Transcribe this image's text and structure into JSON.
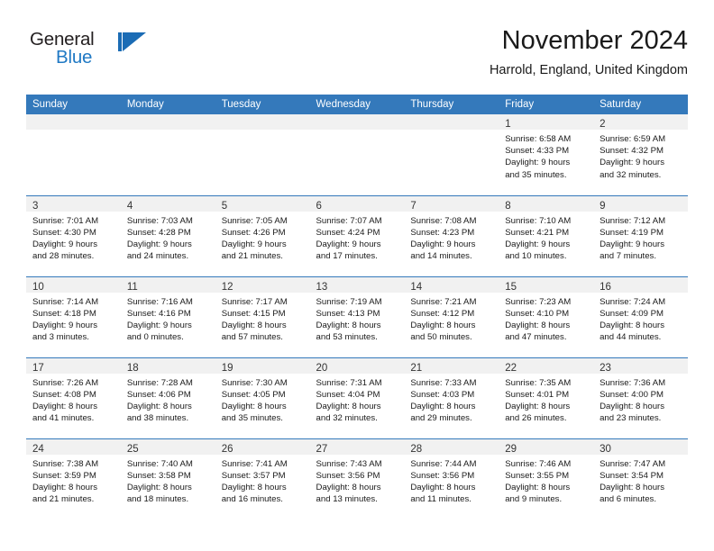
{
  "brand": {
    "name_part1": "General",
    "name_part2": "Blue",
    "accent_color": "#2079c4",
    "logo_icon": "triangle-flag-icon"
  },
  "header": {
    "title": "November 2024",
    "location": "Harrold, England, United Kingdom"
  },
  "calendar": {
    "header_bg": "#3479bb",
    "daynum_band_bg": "#f1f1f1",
    "weekday_headers": [
      "Sunday",
      "Monday",
      "Tuesday",
      "Wednesday",
      "Thursday",
      "Friday",
      "Saturday"
    ],
    "weeks": [
      [
        {
          "day": "",
          "empty": true,
          "lines": []
        },
        {
          "day": "",
          "empty": true,
          "lines": []
        },
        {
          "day": "",
          "empty": true,
          "lines": []
        },
        {
          "day": "",
          "empty": true,
          "lines": []
        },
        {
          "day": "",
          "empty": true,
          "lines": []
        },
        {
          "day": "1",
          "empty": false,
          "lines": [
            "Sunrise: 6:58 AM",
            "Sunset: 4:33 PM",
            "Daylight: 9 hours",
            "and 35 minutes."
          ]
        },
        {
          "day": "2",
          "empty": false,
          "lines": [
            "Sunrise: 6:59 AM",
            "Sunset: 4:32 PM",
            "Daylight: 9 hours",
            "and 32 minutes."
          ]
        }
      ],
      [
        {
          "day": "3",
          "empty": false,
          "lines": [
            "Sunrise: 7:01 AM",
            "Sunset: 4:30 PM",
            "Daylight: 9 hours",
            "and 28 minutes."
          ]
        },
        {
          "day": "4",
          "empty": false,
          "lines": [
            "Sunrise: 7:03 AM",
            "Sunset: 4:28 PM",
            "Daylight: 9 hours",
            "and 24 minutes."
          ]
        },
        {
          "day": "5",
          "empty": false,
          "lines": [
            "Sunrise: 7:05 AM",
            "Sunset: 4:26 PM",
            "Daylight: 9 hours",
            "and 21 minutes."
          ]
        },
        {
          "day": "6",
          "empty": false,
          "lines": [
            "Sunrise: 7:07 AM",
            "Sunset: 4:24 PM",
            "Daylight: 9 hours",
            "and 17 minutes."
          ]
        },
        {
          "day": "7",
          "empty": false,
          "lines": [
            "Sunrise: 7:08 AM",
            "Sunset: 4:23 PM",
            "Daylight: 9 hours",
            "and 14 minutes."
          ]
        },
        {
          "day": "8",
          "empty": false,
          "lines": [
            "Sunrise: 7:10 AM",
            "Sunset: 4:21 PM",
            "Daylight: 9 hours",
            "and 10 minutes."
          ]
        },
        {
          "day": "9",
          "empty": false,
          "lines": [
            "Sunrise: 7:12 AM",
            "Sunset: 4:19 PM",
            "Daylight: 9 hours",
            "and 7 minutes."
          ]
        }
      ],
      [
        {
          "day": "10",
          "empty": false,
          "lines": [
            "Sunrise: 7:14 AM",
            "Sunset: 4:18 PM",
            "Daylight: 9 hours",
            "and 3 minutes."
          ]
        },
        {
          "day": "11",
          "empty": false,
          "lines": [
            "Sunrise: 7:16 AM",
            "Sunset: 4:16 PM",
            "Daylight: 9 hours",
            "and 0 minutes."
          ]
        },
        {
          "day": "12",
          "empty": false,
          "lines": [
            "Sunrise: 7:17 AM",
            "Sunset: 4:15 PM",
            "Daylight: 8 hours",
            "and 57 minutes."
          ]
        },
        {
          "day": "13",
          "empty": false,
          "lines": [
            "Sunrise: 7:19 AM",
            "Sunset: 4:13 PM",
            "Daylight: 8 hours",
            "and 53 minutes."
          ]
        },
        {
          "day": "14",
          "empty": false,
          "lines": [
            "Sunrise: 7:21 AM",
            "Sunset: 4:12 PM",
            "Daylight: 8 hours",
            "and 50 minutes."
          ]
        },
        {
          "day": "15",
          "empty": false,
          "lines": [
            "Sunrise: 7:23 AM",
            "Sunset: 4:10 PM",
            "Daylight: 8 hours",
            "and 47 minutes."
          ]
        },
        {
          "day": "16",
          "empty": false,
          "lines": [
            "Sunrise: 7:24 AM",
            "Sunset: 4:09 PM",
            "Daylight: 8 hours",
            "and 44 minutes."
          ]
        }
      ],
      [
        {
          "day": "17",
          "empty": false,
          "lines": [
            "Sunrise: 7:26 AM",
            "Sunset: 4:08 PM",
            "Daylight: 8 hours",
            "and 41 minutes."
          ]
        },
        {
          "day": "18",
          "empty": false,
          "lines": [
            "Sunrise: 7:28 AM",
            "Sunset: 4:06 PM",
            "Daylight: 8 hours",
            "and 38 minutes."
          ]
        },
        {
          "day": "19",
          "empty": false,
          "lines": [
            "Sunrise: 7:30 AM",
            "Sunset: 4:05 PM",
            "Daylight: 8 hours",
            "and 35 minutes."
          ]
        },
        {
          "day": "20",
          "empty": false,
          "lines": [
            "Sunrise: 7:31 AM",
            "Sunset: 4:04 PM",
            "Daylight: 8 hours",
            "and 32 minutes."
          ]
        },
        {
          "day": "21",
          "empty": false,
          "lines": [
            "Sunrise: 7:33 AM",
            "Sunset: 4:03 PM",
            "Daylight: 8 hours",
            "and 29 minutes."
          ]
        },
        {
          "day": "22",
          "empty": false,
          "lines": [
            "Sunrise: 7:35 AM",
            "Sunset: 4:01 PM",
            "Daylight: 8 hours",
            "and 26 minutes."
          ]
        },
        {
          "day": "23",
          "empty": false,
          "lines": [
            "Sunrise: 7:36 AM",
            "Sunset: 4:00 PM",
            "Daylight: 8 hours",
            "and 23 minutes."
          ]
        }
      ],
      [
        {
          "day": "24",
          "empty": false,
          "lines": [
            "Sunrise: 7:38 AM",
            "Sunset: 3:59 PM",
            "Daylight: 8 hours",
            "and 21 minutes."
          ]
        },
        {
          "day": "25",
          "empty": false,
          "lines": [
            "Sunrise: 7:40 AM",
            "Sunset: 3:58 PM",
            "Daylight: 8 hours",
            "and 18 minutes."
          ]
        },
        {
          "day": "26",
          "empty": false,
          "lines": [
            "Sunrise: 7:41 AM",
            "Sunset: 3:57 PM",
            "Daylight: 8 hours",
            "and 16 minutes."
          ]
        },
        {
          "day": "27",
          "empty": false,
          "lines": [
            "Sunrise: 7:43 AM",
            "Sunset: 3:56 PM",
            "Daylight: 8 hours",
            "and 13 minutes."
          ]
        },
        {
          "day": "28",
          "empty": false,
          "lines": [
            "Sunrise: 7:44 AM",
            "Sunset: 3:56 PM",
            "Daylight: 8 hours",
            "and 11 minutes."
          ]
        },
        {
          "day": "29",
          "empty": false,
          "lines": [
            "Sunrise: 7:46 AM",
            "Sunset: 3:55 PM",
            "Daylight: 8 hours",
            "and 9 minutes."
          ]
        },
        {
          "day": "30",
          "empty": false,
          "lines": [
            "Sunrise: 7:47 AM",
            "Sunset: 3:54 PM",
            "Daylight: 8 hours",
            "and 6 minutes."
          ]
        }
      ]
    ]
  }
}
